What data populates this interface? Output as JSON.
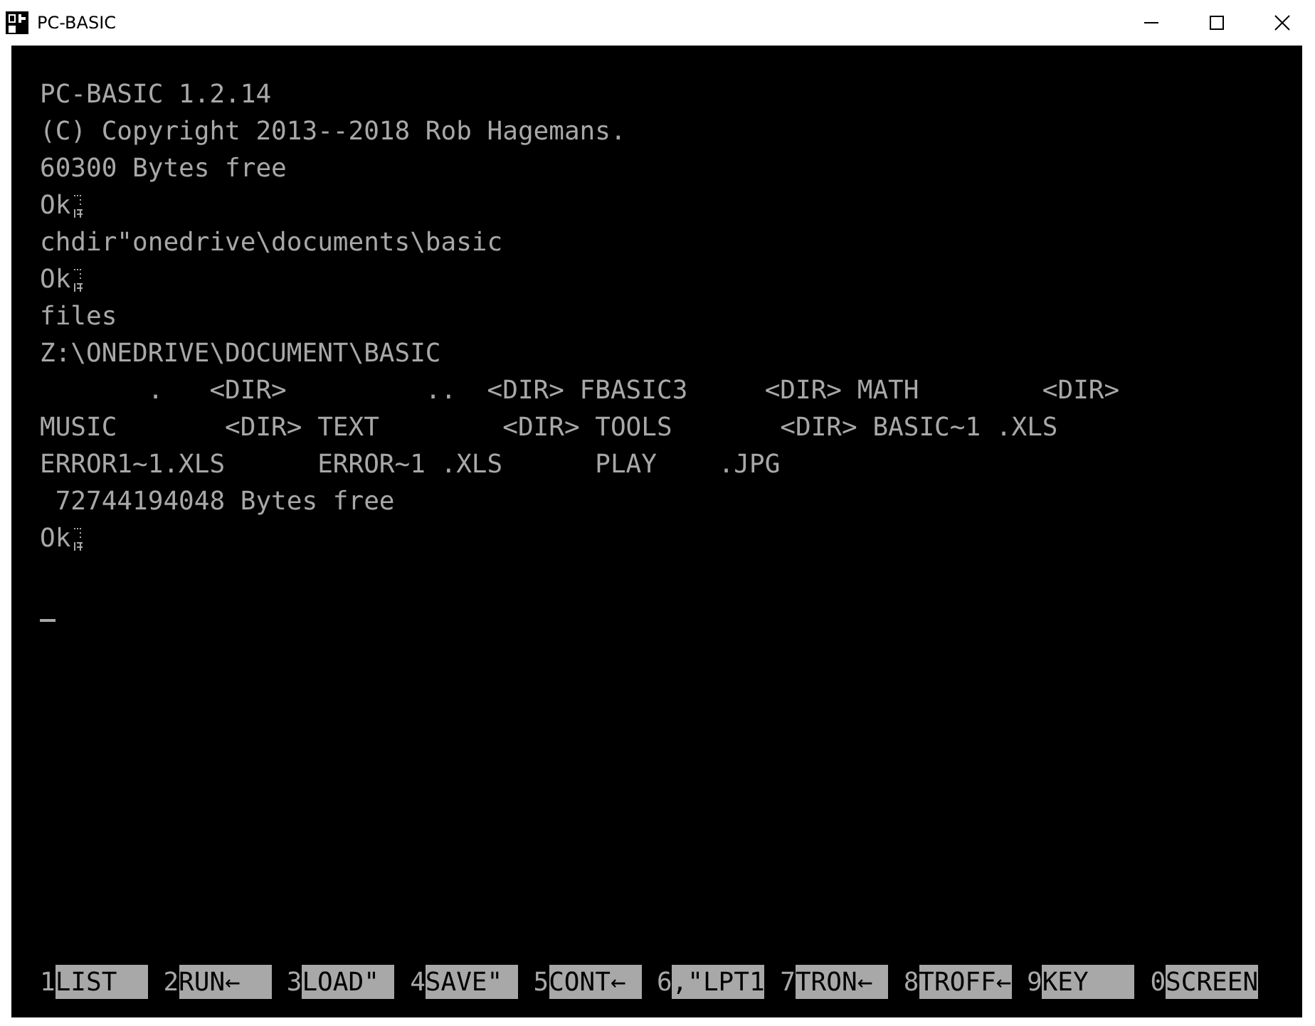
{
  "window": {
    "title": "PC-BASIC"
  },
  "screen": {
    "lines": [
      {
        "kind": "text",
        "text": "PC-BASIC 1.2.14"
      },
      {
        "kind": "text",
        "text": "(C) Copyright 2013--2018 Rob Hagemans."
      },
      {
        "kind": "text",
        "text": "60300 Bytes free"
      },
      {
        "kind": "prompt",
        "text": "Ok"
      },
      {
        "kind": "text",
        "text": "chdir\"onedrive\\documents\\basic"
      },
      {
        "kind": "prompt",
        "text": "Ok"
      },
      {
        "kind": "text",
        "text": "files"
      },
      {
        "kind": "text",
        "text": "Z:\\ONEDRIVE\\DOCUMENT\\BASIC"
      },
      {
        "kind": "text",
        "text": "       .   <DIR>         ..  <DIR> FBASIC3     <DIR> MATH        <DIR>"
      },
      {
        "kind": "text",
        "text": "MUSIC       <DIR> TEXT        <DIR> TOOLS       <DIR> BASIC~1 .XLS"
      },
      {
        "kind": "text",
        "text": "ERROR1~1.XLS      ERROR~1 .XLS      PLAY    .JPG"
      },
      {
        "kind": "text",
        "text": " 72744194048 Bytes free"
      },
      {
        "kind": "prompt",
        "text": "Ok"
      },
      {
        "kind": "blank"
      },
      {
        "kind": "cursor"
      }
    ]
  },
  "function_keys": [
    {
      "number": "1",
      "label": "LIST"
    },
    {
      "number": "2",
      "label": "RUN←"
    },
    {
      "number": "3",
      "label": "LOAD\""
    },
    {
      "number": "4",
      "label": "SAVE\""
    },
    {
      "number": "5",
      "label": "CONT←"
    },
    {
      "number": "6",
      "label": ",\"LPT1"
    },
    {
      "number": "7",
      "label": "TRON←"
    },
    {
      "number": "8",
      "label": "TROFF←"
    },
    {
      "number": "9",
      "label": "KEY"
    },
    {
      "number": "0",
      "label": "SCREEN"
    }
  ]
}
